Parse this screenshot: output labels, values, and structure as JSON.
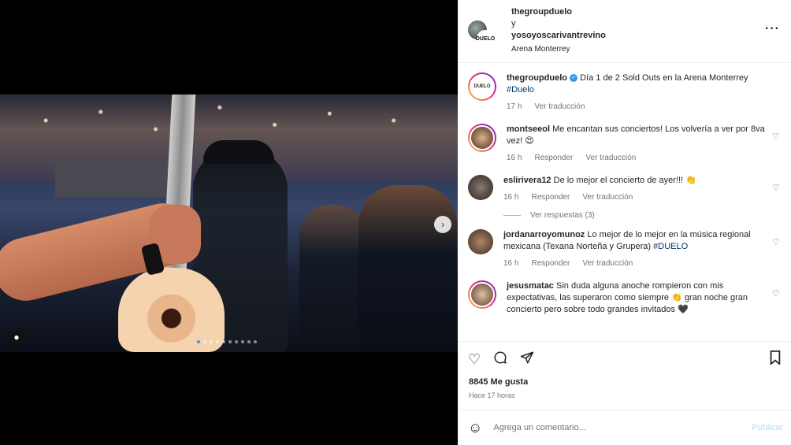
{
  "header": {
    "user1": "thegroupduelo",
    "connector": "y",
    "user2": "yosoyoscarivantrevino",
    "location": "Arena Monterrey",
    "more_icon": "more-horizontal-icon"
  },
  "avatar_badge": "DUELO",
  "caption": {
    "username": "thegroupduelo",
    "text": "Día 1 de 2 Sold Outs en la Arena Monterrey",
    "hashtag": "#Duelo",
    "time": "17 h",
    "translate": "Ver traducción"
  },
  "comments": [
    {
      "username": "montseeol",
      "text": "Me encantan sus conciertos! Los volvería a ver por 8va vez! 😍",
      "time": "16 h",
      "reply": "Responder",
      "translate": "Ver traducción"
    },
    {
      "username": "eslirivera12",
      "text": "De lo mejor el concierto de ayer!!! 👏",
      "time": "16 h",
      "reply": "Responder",
      "translate": "Ver traducción",
      "view_replies": "Ver respuestas (3)"
    },
    {
      "username": "jordanarroyomunoz",
      "text": "Lo mejor de lo mejor en la música regional mexicana (Texana Norteña y Grupera)",
      "hashtag": "#DUELO",
      "time": "16 h",
      "reply": "Responder",
      "translate": "Ver traducción"
    },
    {
      "username": "jesusmatac",
      "text": "Sin duda alguna anoche rompieron con mis expectativas, las superaron como siempre 👏 gran noche gran concierto pero sobre todo grandes invitados 🖤"
    }
  ],
  "likes": "8845 Me gusta",
  "posted": "Hace 17 horas",
  "add_comment": {
    "placeholder": "Agrega un comentario...",
    "publish": "Publicar"
  },
  "carousel": {
    "count": 10,
    "active": 0
  },
  "colors": {
    "accent": "#3797f0",
    "link": "#00376b",
    "muted": "#737373"
  }
}
